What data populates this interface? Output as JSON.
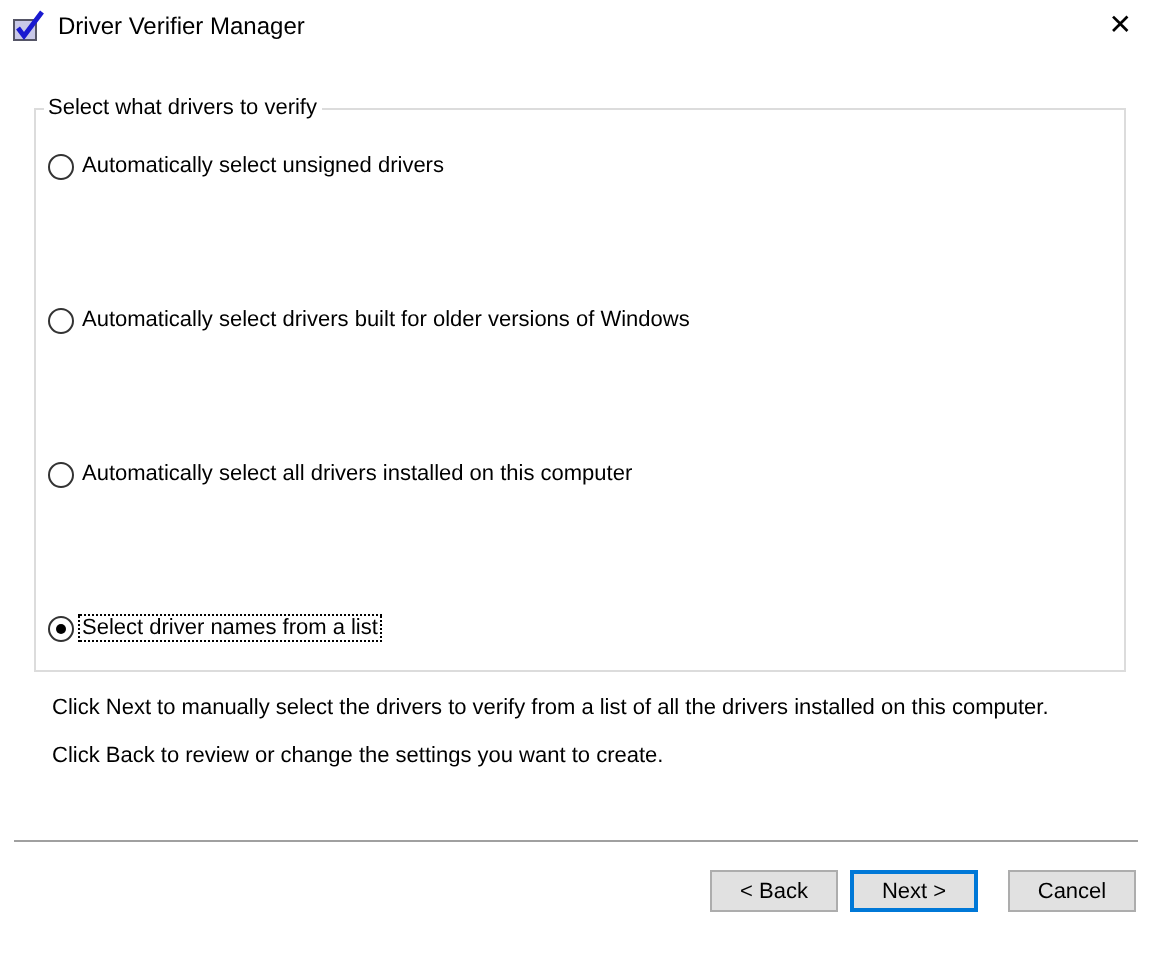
{
  "window": {
    "title": "Driver Verifier Manager",
    "close": "✕"
  },
  "group": {
    "title": "Select what drivers to verify",
    "options": [
      {
        "label": "Automatically select unsigned drivers",
        "selected": false
      },
      {
        "label": "Automatically select drivers built for older versions of Windows",
        "selected": false
      },
      {
        "label": "Automatically select all drivers installed on this computer",
        "selected": false
      },
      {
        "label": "Select driver names from a list",
        "selected": true
      }
    ]
  },
  "hints": [
    "Click Next to manually select the drivers to verify from a list of all the drivers installed on this computer.",
    "Click Back to review or change the settings you want to create."
  ],
  "buttons": [
    {
      "label": "< Back",
      "default": false
    },
    {
      "label": "Next >",
      "default": true
    },
    {
      "label": "Cancel",
      "default": false
    }
  ]
}
